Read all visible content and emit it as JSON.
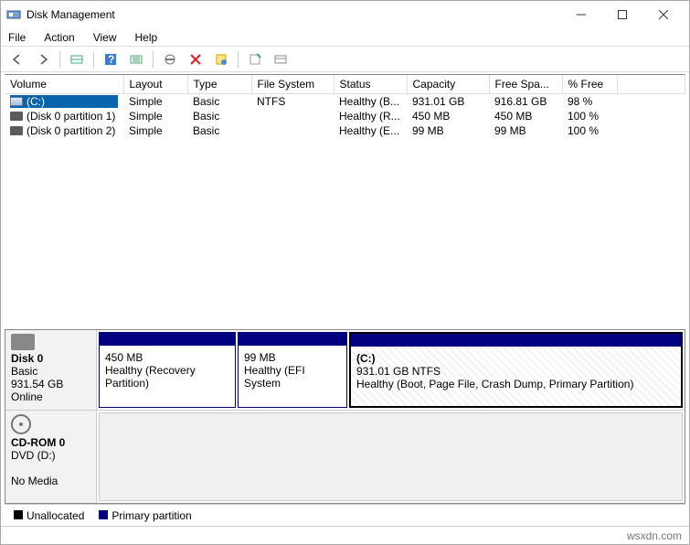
{
  "window": {
    "title": "Disk Management"
  },
  "menu": {
    "file": "File",
    "action": "Action",
    "view": "View",
    "help": "Help"
  },
  "columns": {
    "volume": "Volume",
    "layout": "Layout",
    "type": "Type",
    "fs": "File System",
    "status": "Status",
    "capacity": "Capacity",
    "free": "Free Spa...",
    "pct": "% Free"
  },
  "vols": [
    {
      "name": "(C:)",
      "layout": "Simple",
      "type": "Basic",
      "fs": "NTFS",
      "status": "Healthy (B...",
      "capacity": "931.01 GB",
      "free": "916.81 GB",
      "pct": "98 %",
      "selected": true,
      "icon": "drive"
    },
    {
      "name": "(Disk 0 partition 1)",
      "layout": "Simple",
      "type": "Basic",
      "fs": "",
      "status": "Healthy (R...",
      "capacity": "450 MB",
      "free": "450 MB",
      "pct": "100 %",
      "selected": false,
      "icon": "hdd"
    },
    {
      "name": "(Disk 0 partition 2)",
      "layout": "Simple",
      "type": "Basic",
      "fs": "",
      "status": "Healthy (E...",
      "capacity": "99 MB",
      "free": "99 MB",
      "pct": "100 %",
      "selected": false,
      "icon": "hdd"
    }
  ],
  "disk0": {
    "title": "Disk 0",
    "type": "Basic",
    "size": "931.54 GB",
    "state": "Online",
    "p1": {
      "size": "450 MB",
      "status": "Healthy (Recovery Partition)"
    },
    "p2": {
      "size": "99 MB",
      "status": "Healthy (EFI System"
    },
    "p3": {
      "name": "(C:)",
      "size": "931.01 GB NTFS",
      "status": "Healthy (Boot, Page File, Crash Dump, Primary Partition)"
    }
  },
  "cdrom": {
    "title": "CD-ROM 0",
    "type": "DVD (D:)",
    "state": "No Media"
  },
  "legend": {
    "unalloc": "Unallocated",
    "primary": "Primary partition"
  },
  "attribution": "wsxdn.com"
}
